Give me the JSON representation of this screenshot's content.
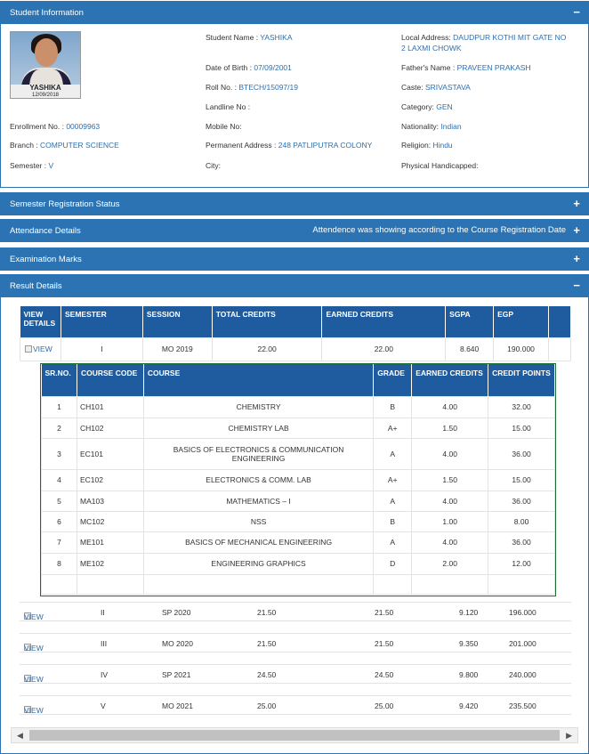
{
  "student_panel": {
    "title": "Student Information",
    "toggle": "−",
    "photo_caption_name": "YASHIKA",
    "photo_caption_date": "12/09/2018",
    "fields": {
      "student_name_label": "Student Name :",
      "student_name": "YASHIKA",
      "dob_label": "Date of Birth :",
      "dob": "07/09/2001",
      "roll_label": "Roll No. :",
      "roll": "BTECH/15097/19",
      "landline_label": "Landline No :",
      "mobile_label": "Mobile No:",
      "permanent_address_label": "Permanent Address :",
      "permanent_address": "248 PATLIPUTRA COLONY",
      "city_label": "City:",
      "local_address_label": "Local Address:",
      "local_address_line1": "DAUDPUR KOTHI MIT GATE NO",
      "local_address_line2": "2 LAXMI CHOWK",
      "father_label": "Father's Name :",
      "father": "PRAVEEN PRAKASH",
      "caste_label": "Caste:",
      "caste": "SRIVASTAVA",
      "category_label": "Category:",
      "category": "GEN",
      "nationality_label": "Nationality:",
      "nationality": "Indian",
      "religion_label": "Religion:",
      "religion": "Hindu",
      "physical_label": "Physical Handicapped:",
      "enrollment_label": "Enrollment No. :",
      "enrollment": "00009963",
      "branch_label": "Branch :",
      "branch": "COMPUTER SCIENCE",
      "semester_label": "Semester :",
      "semester": "V"
    }
  },
  "sections": {
    "semester_registration": {
      "title": "Semester Registration Status",
      "toggle": "+"
    },
    "attendance": {
      "title": "Attendance Details",
      "note": "Attendence was showing according to the Course Registration Date",
      "toggle": "+"
    },
    "examination": {
      "title": "Examination Marks",
      "toggle": "+"
    },
    "result": {
      "title": "Result Details",
      "toggle": "−"
    }
  },
  "results": {
    "headers": [
      "VIEW DETAILS",
      "SEMESTER",
      "SESSION",
      "TOTAL CREDITS",
      "EARNED CREDITS",
      "SGPA",
      "EGP"
    ],
    "view_label": "VIEW",
    "semesters": [
      {
        "semester": "I",
        "session": "MO 2019",
        "total": "22.00",
        "earned": "22.00",
        "sgpa": "8.640",
        "egp": "190.000"
      },
      {
        "semester": "II",
        "session": "SP 2020",
        "total": "21.50",
        "earned": "21.50",
        "sgpa": "9.120",
        "egp": "196.000"
      },
      {
        "semester": "III",
        "session": "MO 2020",
        "total": "21.50",
        "earned": "21.50",
        "sgpa": "9.350",
        "egp": "201.000"
      },
      {
        "semester": "IV",
        "session": "SP 2021",
        "total": "24.50",
        "earned": "24.50",
        "sgpa": "9.800",
        "egp": "240.000"
      },
      {
        "semester": "V",
        "session": "MO 2021",
        "total": "25.00",
        "earned": "25.00",
        "sgpa": "9.420",
        "egp": "235.500"
      }
    ],
    "course_headers": [
      "SR.NO.",
      "COURSE CODE",
      "COURSE",
      "GRADE",
      "EARNED CREDITS",
      "CREDIT POINTS"
    ],
    "courses": [
      {
        "sr": "1",
        "code": "CH101",
        "course": "CHEMISTRY",
        "grade": "B",
        "earned": "4.00",
        "points": "32.00"
      },
      {
        "sr": "2",
        "code": "CH102",
        "course": "CHEMISTRY LAB",
        "grade": "A+",
        "earned": "1.50",
        "points": "15.00"
      },
      {
        "sr": "3",
        "code": "EC101",
        "course": "BASICS OF ELECTRONICS & COMMUNICATION ENGINEERING",
        "grade": "A",
        "earned": "4.00",
        "points": "36.00"
      },
      {
        "sr": "4",
        "code": "EC102",
        "course": "ELECTRONICS & COMM. LAB",
        "grade": "A+",
        "earned": "1.50",
        "points": "15.00"
      },
      {
        "sr": "5",
        "code": "MA103",
        "course": "MATHEMATICS – I",
        "grade": "A",
        "earned": "4.00",
        "points": "36.00"
      },
      {
        "sr": "6",
        "code": "MC102",
        "course": "NSS",
        "grade": "B",
        "earned": "1.00",
        "points": "8.00"
      },
      {
        "sr": "7",
        "code": "ME101",
        "course": "BASICS OF MECHANICAL ENGINEERING",
        "grade": "A",
        "earned": "4.00",
        "points": "36.00"
      },
      {
        "sr": "8",
        "code": "ME102",
        "course": "ENGINEERING GRAPHICS",
        "grade": "D",
        "earned": "2.00",
        "points": "12.00"
      }
    ]
  },
  "colors": {
    "header": "#2b73b3",
    "table_header": "#1e5c9f",
    "value": "#2d6fae",
    "course_border": "#1e6e2e"
  },
  "icons": {
    "expand": "plus-icon",
    "collapse": "minus-icon",
    "view": "broken-image-icon",
    "scroll_left": "triangle-left-icon",
    "scroll_right": "triangle-right-icon"
  }
}
